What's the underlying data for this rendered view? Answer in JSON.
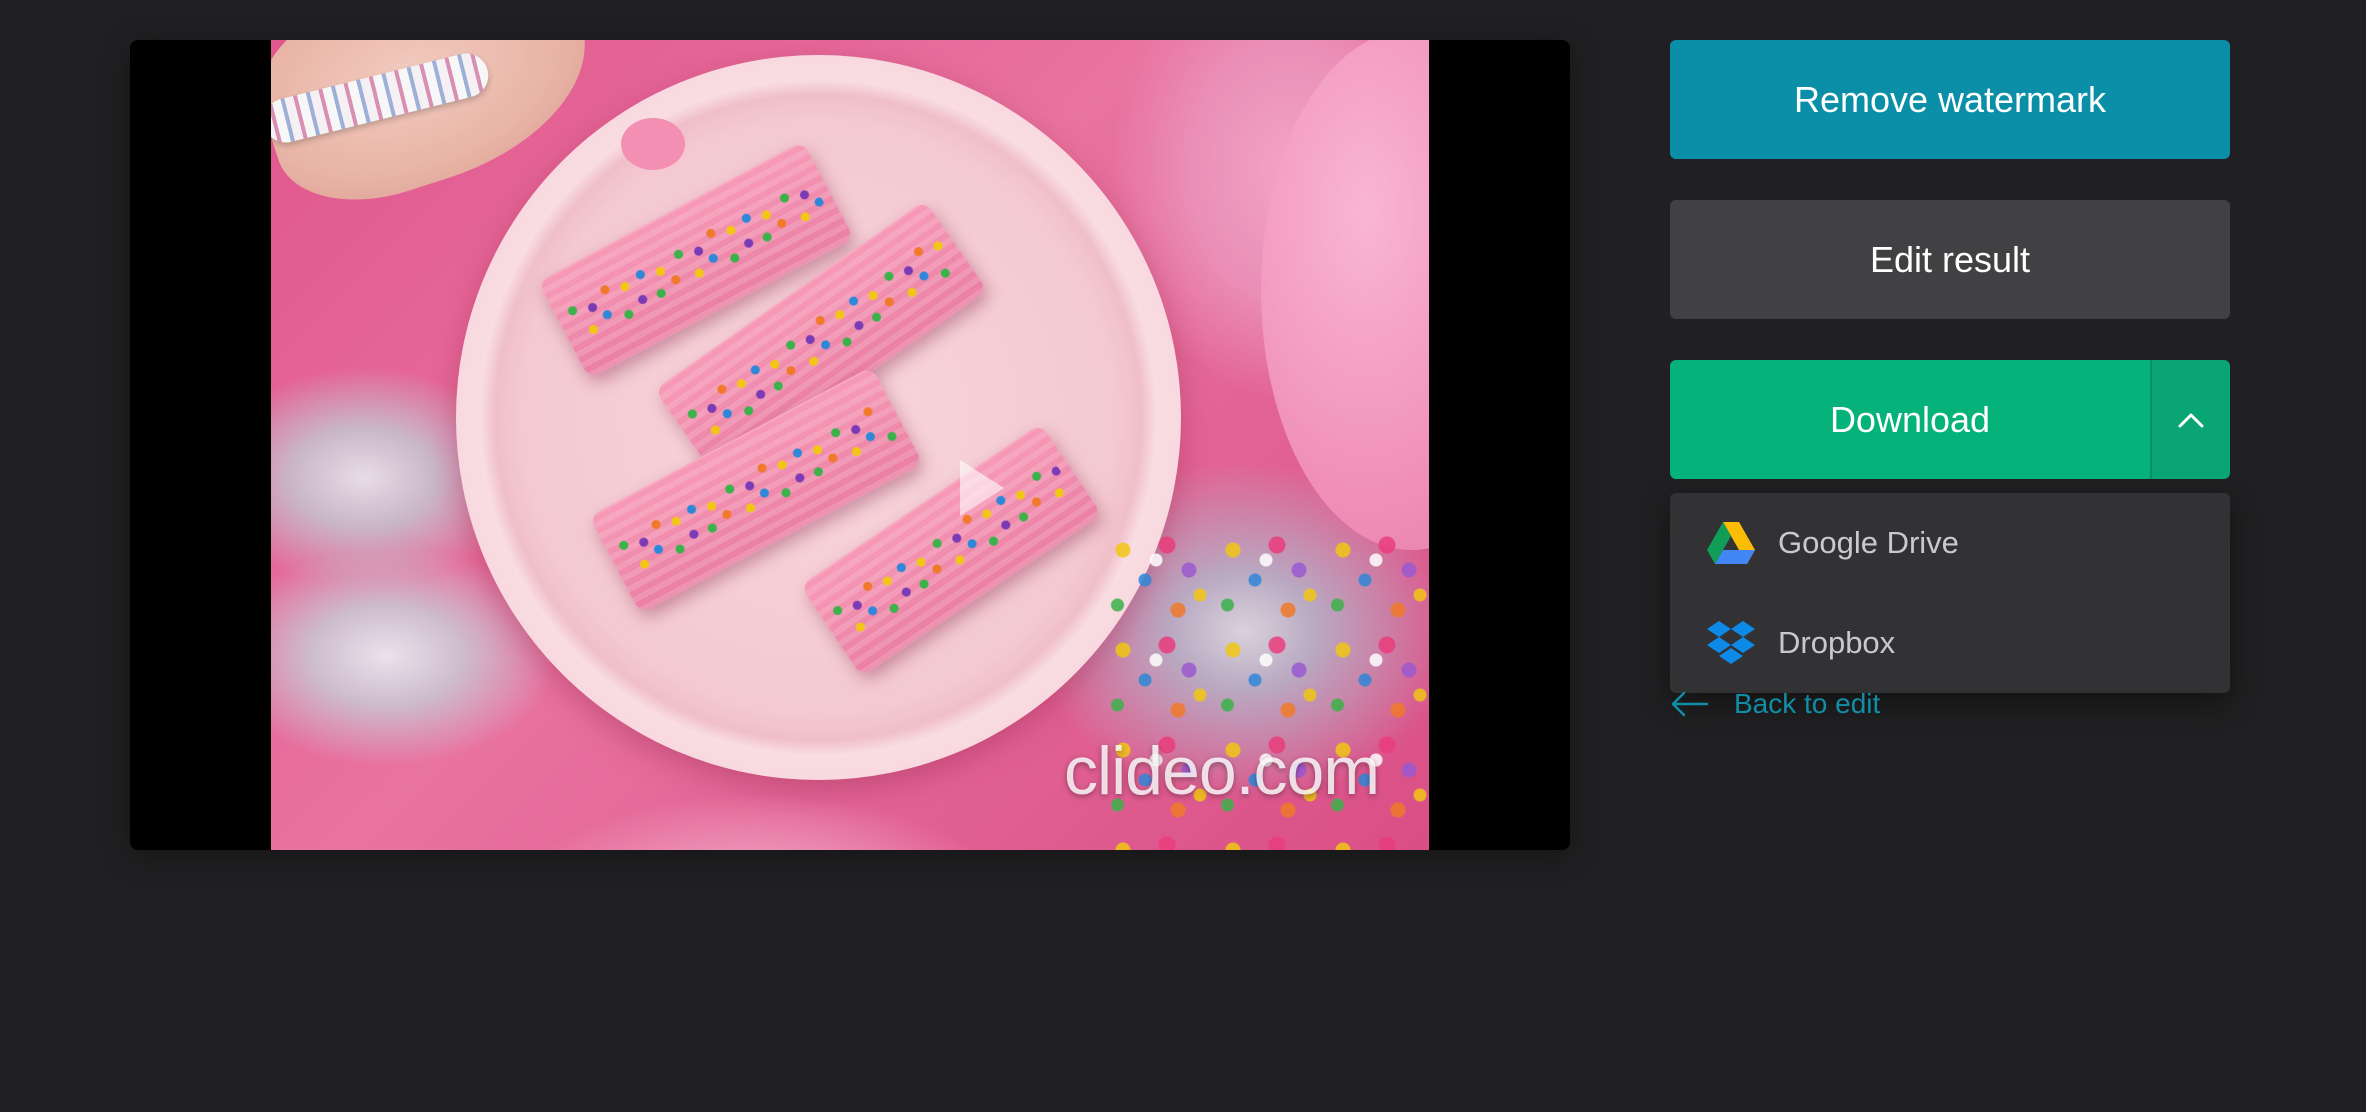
{
  "player": {
    "watermark_text": "clideo.com",
    "play_icon": "play-icon"
  },
  "actions": {
    "remove_watermark_label": "Remove watermark",
    "edit_result_label": "Edit result",
    "download_label": "Download",
    "download_toggle_icon": "chevron-up-icon"
  },
  "download_menu": {
    "items": [
      {
        "label": "Google Drive",
        "icon": "google-drive-icon"
      },
      {
        "label": "Dropbox",
        "icon": "dropbox-icon"
      }
    ]
  },
  "back_link": {
    "label": "Back to edit",
    "icon": "arrow-left-icon"
  },
  "colors": {
    "background": "#202022",
    "remove_watermark": "#0b8fa8",
    "edit_result": "#414144",
    "download": "#05b27a",
    "menu": "#323235",
    "link": "#0f8ea6"
  }
}
